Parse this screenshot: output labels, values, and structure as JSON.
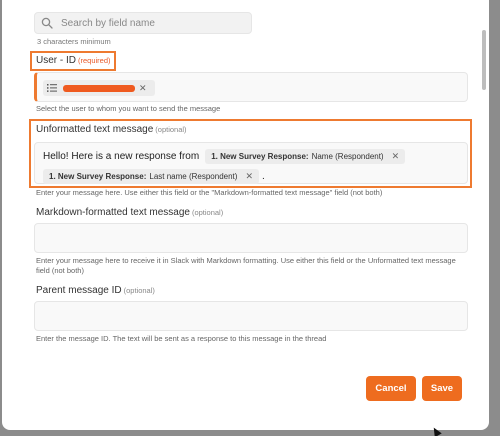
{
  "search": {
    "placeholder": "Search by field name",
    "hint": "3 characters minimum"
  },
  "user_id": {
    "label": "User - ID",
    "required": "(required)",
    "help": "Select the user to whom you want to send the message"
  },
  "unformatted": {
    "label": "Unformatted text message",
    "optional": "(optional)",
    "prefix": "Hello! Here is a new response from",
    "pill1_bold": "1. New Survey Response:",
    "pill1_rest": "Name (Respondent)",
    "pill2_bold": "1. New Survey Response:",
    "pill2_rest": "Last name (Respondent)",
    "suffix": ".",
    "help": "Enter your message here. Use either this field or the \"Markdown-formatted text message\" field (not both)"
  },
  "markdown": {
    "label": "Markdown-formatted text message",
    "optional": "(optional)",
    "help": "Enter your message here to receive it in Slack with Markdown formatting. Use either this field or the Unformatted text message field (not both)"
  },
  "parent": {
    "label": "Parent message ID",
    "optional": "(optional)",
    "help": "Enter the message ID. The text will be sent as a response to this message in the thread"
  },
  "buttons": {
    "cancel": "Cancel",
    "save": "Save"
  },
  "colors": {
    "accent": "#ee6c1f",
    "highlight": "#ee7a30",
    "required": "#e85a2a"
  }
}
